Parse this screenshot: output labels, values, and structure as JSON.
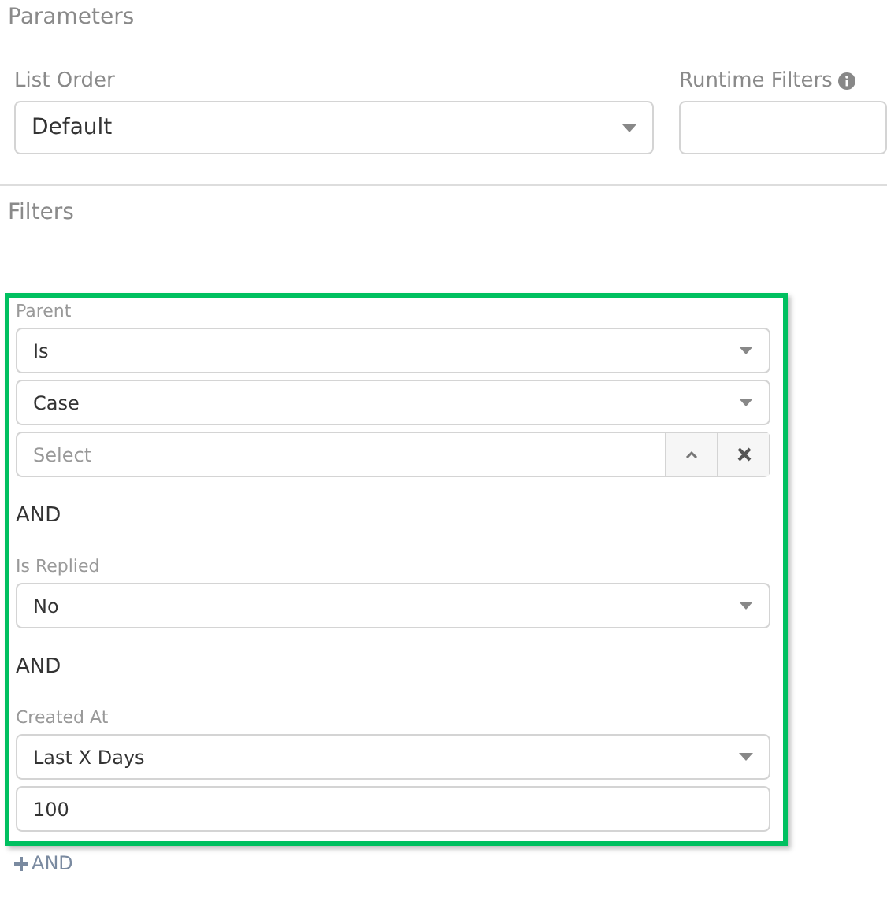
{
  "parameters": {
    "title": "Parameters",
    "fields": [
      {
        "label": "List Order",
        "kind": "select",
        "value": "Default"
      },
      {
        "label": "Runtime Filters",
        "kind": "input",
        "info": true
      }
    ]
  },
  "filters": {
    "title": "Filters",
    "highlighted": true,
    "items": [
      {
        "kind": "field",
        "label": "Parent",
        "controls": [
          {
            "kind": "select",
            "value": "Is"
          },
          {
            "kind": "select",
            "value": "Case"
          },
          {
            "kind": "lookup",
            "placeholder": "Select"
          }
        ]
      },
      {
        "kind": "connector",
        "text": "AND"
      },
      {
        "kind": "field",
        "label": "Is Replied",
        "controls": [
          {
            "kind": "select",
            "value": "No"
          }
        ]
      },
      {
        "kind": "connector",
        "text": "AND"
      },
      {
        "kind": "field",
        "label": "Created At",
        "controls": [
          {
            "kind": "select",
            "value": "Last X Days"
          },
          {
            "kind": "input",
            "value": "100"
          }
        ]
      }
    ],
    "add_button": "AND"
  }
}
